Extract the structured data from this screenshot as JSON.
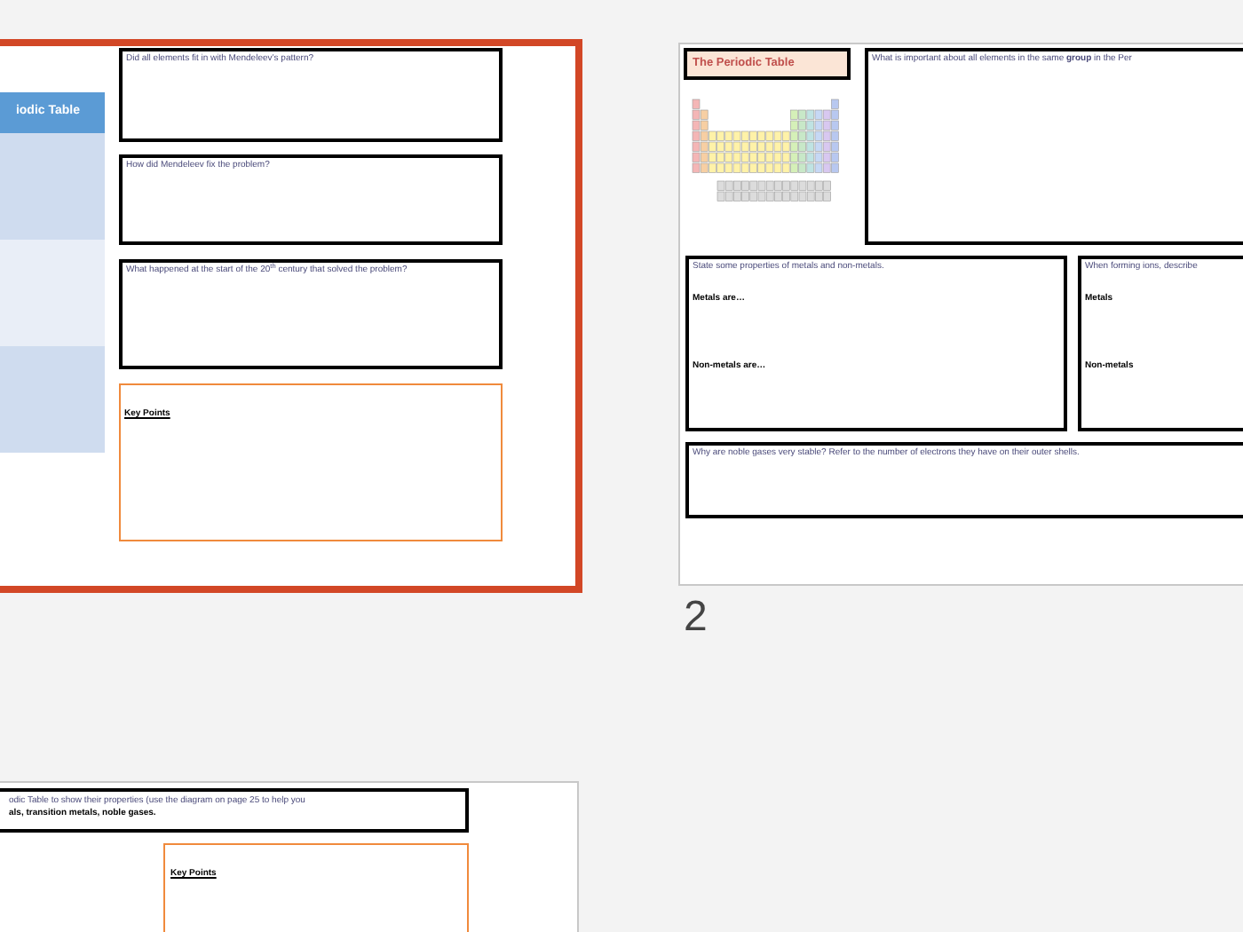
{
  "slides": [
    {
      "kind": "mendeleev",
      "selected": true,
      "table_header": "iodic Table",
      "questions": [
        "Did all elements fit in with Mendeleev’s pattern?",
        "How did Mendeleev fix the problem?",
        "What happened at the start of the 20$^{th}$ century that solved the problem?"
      ],
      "key_points": "Key Points"
    },
    {
      "kind": "overview",
      "selected": false,
      "number": "2",
      "title": "The Periodic Table",
      "group_question": "What is important about all elements in the same **group** in the Per",
      "properties_prompt": "State some properties of metals and non-metals.",
      "metals_label": "Metals are…",
      "nonmetals_label": "Non-metals are…",
      "ions_prompt": "When forming ions, describe",
      "ions_metals": "Metals",
      "ions_nonmetals": "Non-metals",
      "noble_question": "Why are noble gases very stable? Refer to the number of electrons they have on their outer shells."
    },
    {
      "kind": "activity",
      "selected": false,
      "task_lines": [
        "odic Table to show their properties (use the diagram on page 25 to help you",
        "als, transition metals, noble gases."
      ],
      "key_points": "Key Points"
    }
  ]
}
